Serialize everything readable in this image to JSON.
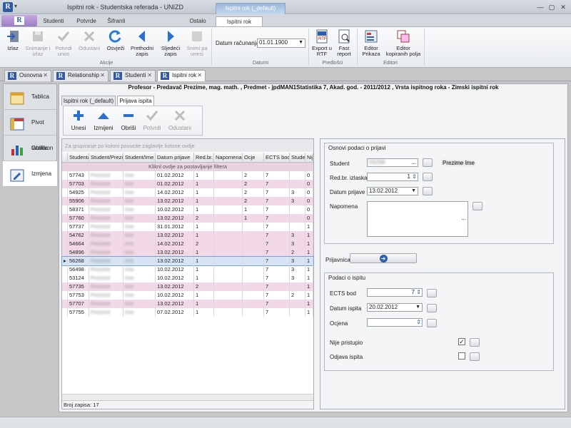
{
  "window": {
    "title": "Ispitni rok - Studentska referada - UNIZD",
    "context_tab": "Ispitni rok (_default)",
    "app_letter": "R",
    "quick_access": "▾",
    "btn_min": "—",
    "btn_max": "▢",
    "btn_close": "✕"
  },
  "ribbon_tabs": [
    "Studenti",
    "Potvrde",
    "Šifranti",
    "Ostalo",
    "Ispitni rok"
  ],
  "ribbon": {
    "izlaz": "Izlaz",
    "snimanje": "Snimanje i izlaz",
    "potvrdi": "Potvrdi unos",
    "odustani": "Odustani",
    "osvjezi": "Osvježi",
    "prethodni": "Prethodni zapis",
    "sljedeci": "Sljedeći zapis",
    "snimi": "Snimi pa unesi",
    "group_akcije": "Akcije",
    "datum_label": "Datum računanja",
    "datum_value": "01.01.1900",
    "group_datumi": "Datumi",
    "export": "Export u RTF",
    "fast": "Fast report",
    "group_predlosci": "Predlošci",
    "editor_prikaza": "Editor Prikaza",
    "editor_kopiranih": "Editor kopiranih polja",
    "group_editori": "Editori"
  },
  "doc_tabs": [
    "Osnovna",
    "Relationship",
    "Studenti",
    "Ispitni rok"
  ],
  "leftnav": [
    "Tablica",
    "Pivot tablica",
    "Grafikon",
    "Izmjena"
  ],
  "info_line": "Profesor - Predavač Prezime, mag. math. , Predmet - jpdMAN1Statistika 7, Akad. god. - 2011/2012 , Vrsta ispitnog roka - Zimski ispitni rok",
  "sub_tabs": [
    "Ispitni rok (_default)",
    "Prijava ispita"
  ],
  "toolbar": {
    "unesi": "Unesi",
    "izmijeni": "Izmijeni",
    "obrisi": "Obriši",
    "potvrdi": "Potvrdi",
    "odustani": "Odustani"
  },
  "grid": {
    "group_hint": "Za grupiranje po koloni povucite zaglavlje kolone ovdje",
    "filter_hint": "Kliknl ovdje za postavljanje filtera",
    "columns": [
      "Student/",
      "Student/Prezir",
      "Student/Ime",
      "Datum prijave",
      "Red.br.",
      "Napomena",
      "Ocje",
      "ECTS bod",
      "Stude",
      "Nije"
    ],
    "rows": [
      [
        "57743",
        "Prezime",
        "Ime",
        "01.02.2012",
        "1",
        "",
        "2",
        "7",
        "",
        "0"
      ],
      [
        "57703",
        "Prezime",
        "Ime",
        "01.02.2012",
        "1",
        "",
        "2",
        "7",
        "",
        "0"
      ],
      [
        "54925",
        "Prezime",
        "Ime",
        "14.02.2012",
        "1",
        "",
        "2",
        "7",
        "3",
        "0"
      ],
      [
        "55906",
        "Prezime",
        "Ime",
        "13.02.2012",
        "1",
        "",
        "2",
        "7",
        "3",
        "0"
      ],
      [
        "58371",
        "Prezime",
        "Ime",
        "10.02.2012",
        "1",
        "",
        "1",
        "7",
        "",
        "0"
      ],
      [
        "57760",
        "Prezime",
        "Ime",
        "13.02.2012",
        "2",
        "",
        "1",
        "7",
        "",
        "0"
      ],
      [
        "57737",
        "Prezime",
        "Ime",
        "31.01.2012",
        "1",
        "",
        "",
        "7",
        "",
        "1"
      ],
      [
        "54762",
        "Prezime",
        "Ime",
        "13.02.2012",
        "1",
        "",
        "",
        "7",
        "3",
        "1"
      ],
      [
        "54664",
        "Prezime",
        "Ime",
        "14.02.2012",
        "2",
        "",
        "",
        "7",
        "3",
        "1"
      ],
      [
        "54896",
        "Prezime",
        "Ime",
        "13.02.2012",
        "1",
        "",
        "",
        "7",
        "2",
        "1"
      ],
      [
        "56268",
        "Prezime",
        "Ime",
        "13.02.2012",
        "1",
        "",
        "",
        "7",
        "3",
        "1"
      ],
      [
        "56498",
        "Prezime",
        "Ime",
        "10.02.2012",
        "1",
        "",
        "",
        "7",
        "3",
        "1"
      ],
      [
        "53124",
        "Prezime",
        "Ime",
        "10.02.2012",
        "1",
        "",
        "",
        "7",
        "3",
        "1"
      ],
      [
        "57735",
        "Prezime",
        "Ime",
        "13.02.2012",
        "2",
        "",
        "",
        "7",
        "",
        "1"
      ],
      [
        "57753",
        "Prezime",
        "Ime",
        "10.02.2012",
        "1",
        "",
        "",
        "7",
        "2",
        "1"
      ],
      [
        "57707",
        "Prezime",
        "Ime",
        "13.02.2012",
        "1",
        "",
        "",
        "7",
        "",
        "1"
      ],
      [
        "57755",
        "Prezime",
        "Ime",
        "07.02.2012",
        "1",
        "",
        "",
        "7",
        "",
        "1"
      ]
    ],
    "footer": "Broj zapisa: 17"
  },
  "form": {
    "osnovni_legend": "Osnovi podaci o prijavi",
    "student_label": "Student",
    "student_value": "56268",
    "student_name": "Prezime Ime",
    "redbr_label": "Red.br. izlaska",
    "redbr_value": "1",
    "datum_label": "Datum prijave",
    "datum_value": "13.02.2012",
    "napomena_label": "Napomena",
    "napomena_dots": "...",
    "ellipsis": "...",
    "spin": "⇕",
    "prijavnica_label": "Prijavnica",
    "prijavnica_icon": "➜",
    "ispit_legend": "Podaci o ispitu",
    "ects_label": "ECTS bod",
    "ects_value": "7",
    "datum_ispita_label": "Datum ispita",
    "datum_ispita_value": "20.02.2012",
    "ocjena_label": "Ocjena",
    "ocjena_value": "",
    "nije_label": "Nije pristupio",
    "nije_check": "✓",
    "odjava_label": "Odjava ispita"
  }
}
